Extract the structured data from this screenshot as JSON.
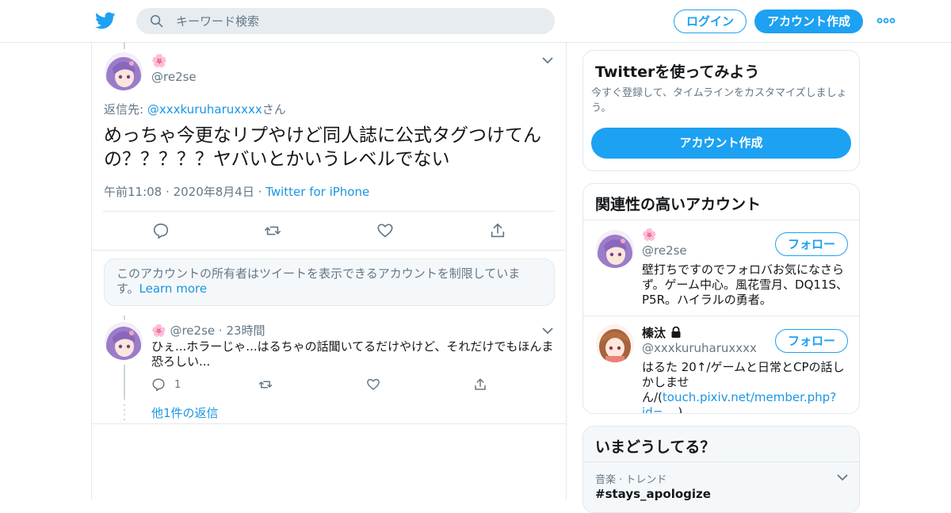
{
  "search": {
    "placeholder": "キーワード検索"
  },
  "header": {
    "login_label": "ログイン",
    "signup_label": "アカウント作成"
  },
  "tweet": {
    "avatar_emoji": "🌸",
    "handle": "@re2se",
    "replying_prefix": "返信先: ",
    "replying_to": "@xxxkuruharuxxxx",
    "replying_suffix": "さん",
    "text": "めっちゃ今更なリプやけど同人誌に公式タグつけてんの？？？？？ヤバいとかいうレベルでない",
    "time": "午前11:08",
    "date": "2020年8月4日",
    "source": "Twitter for iPhone"
  },
  "notice": {
    "text": "このアカウントの所有者はツイートを表示できるアカウントを制限しています。",
    "learn_more": "Learn more"
  },
  "reply": {
    "flower": "🌸",
    "handle": "@re2se",
    "time": "23時間",
    "text": "ひぇ...ホラーじゃ...はるちゃの話聞いてるだけやけど、それだけでもほんま恐ろしい...",
    "reply_count": "1",
    "more_replies": "他1件の返信"
  },
  "signup_card": {
    "title": "Twitterを使ってみよう",
    "subtitle": "今すぐ登録して、タイムラインをカスタマイズしましょう。",
    "button": "アカウント作成"
  },
  "related": {
    "title": "関連性の高いアカウント",
    "follow_label": "フォロー",
    "accounts": [
      {
        "name": "🌸",
        "handle": "@re2se",
        "bio": "壁打ちですのでフォロバお気になさらず。ゲーム中心。風花雪月、DQ11S、P5R。ハイラルの勇者。"
      },
      {
        "name": "榛汰",
        "handle": "@xxxkuruharuxxxx",
        "bio_text": "はるた 20↑/ゲームと日常とCPの話しかしません/(",
        "bio_link": "touch.pixiv.net/member.php?id=...",
        "bio_end": " )"
      }
    ]
  },
  "trends": {
    "title": "いまどうしてる？",
    "items": [
      {
        "category": "音楽 · トレンド",
        "name": "#stays_apologize"
      }
    ]
  },
  "colors": {
    "accent": "#1da1f2",
    "link": "#1b95e0",
    "muted": "#657786",
    "border": "#e1e8ed"
  }
}
